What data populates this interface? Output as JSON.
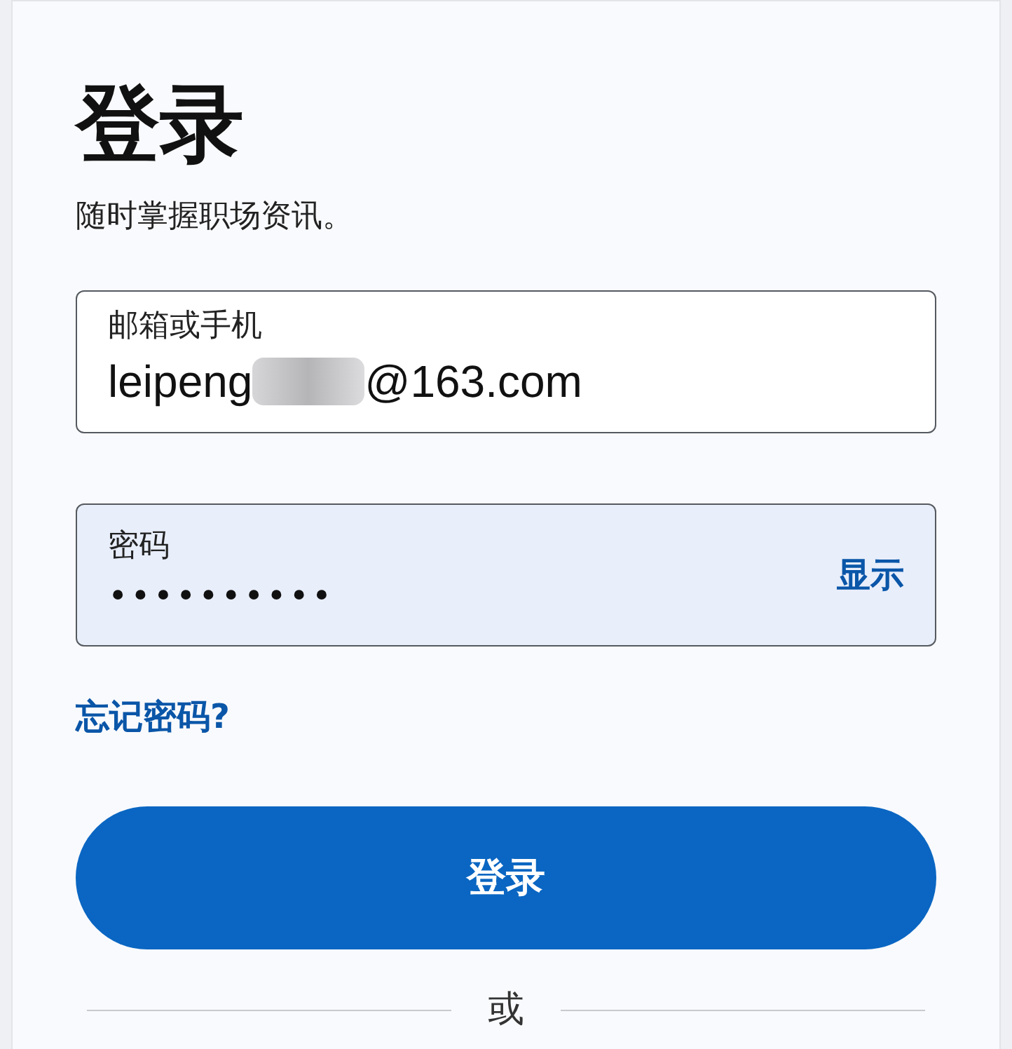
{
  "title": "登录",
  "subtitle": "随时掌握职场资讯。",
  "email_field": {
    "label": "邮箱或手机",
    "value_start": "leipeng",
    "redacted": true,
    "value_end": "@163.com",
    "focused": false
  },
  "password_field": {
    "label": "密码",
    "value": "••••••••••",
    "toggle": "显示",
    "autofilled": true
  },
  "forgot_link": "忘记密码?",
  "submit_button": "登录",
  "divider": "或"
}
